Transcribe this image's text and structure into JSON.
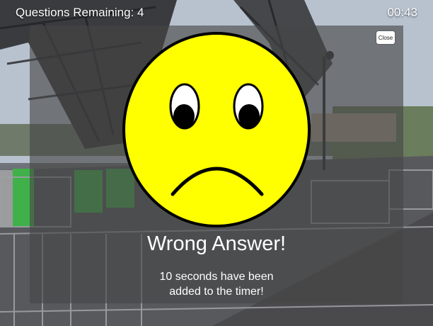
{
  "hud": {
    "questions_remaining": "Questions Remaining: 4",
    "timer": "00:43"
  },
  "modal": {
    "close_label": "Close",
    "face_icon": "sad-face-icon",
    "title": "Wrong Answer!",
    "message_line1": "10 seconds have been",
    "message_line2": "added to the timer!"
  },
  "colors": {
    "face_fill": "#ffff00",
    "overlay": "#464646",
    "text": "#ffffff"
  }
}
